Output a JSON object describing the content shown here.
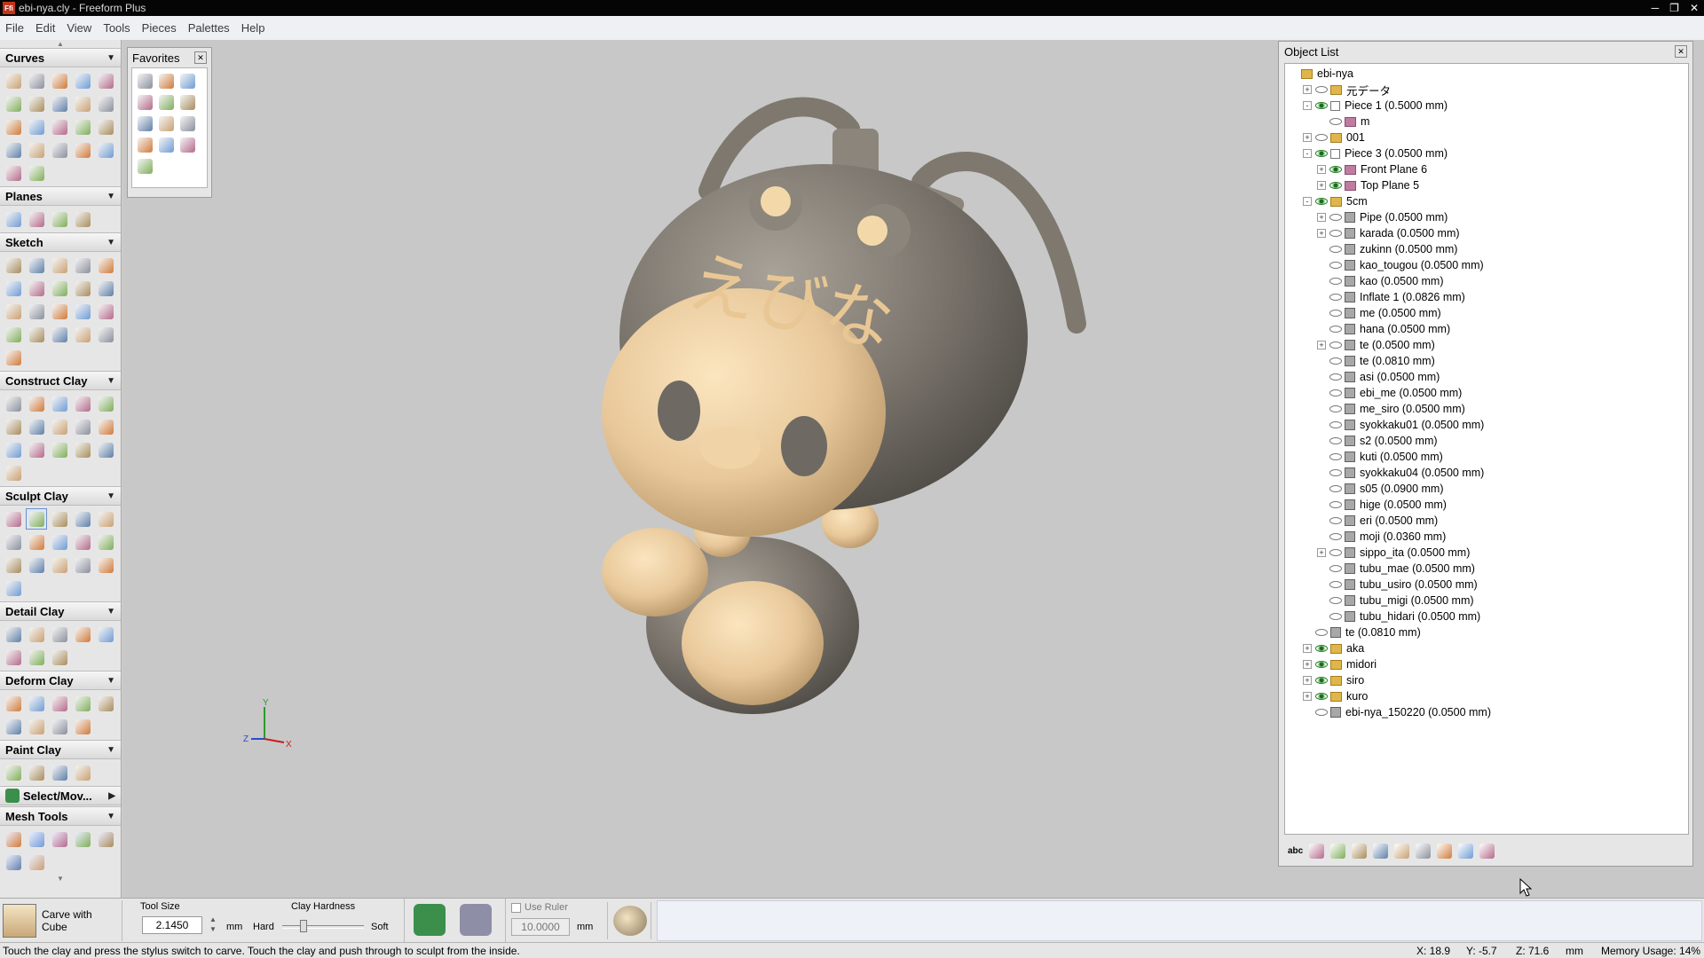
{
  "window": {
    "title": "ebi-nya.cly - Freeform Plus",
    "app_icon": "Ffi",
    "buttons": [
      "─",
      "❐",
      "✕"
    ]
  },
  "menu": [
    "File",
    "Edit",
    "View",
    "Tools",
    "Pieces",
    "Palettes",
    "Help"
  ],
  "palette": {
    "sections": [
      {
        "label": "Curves",
        "rows": 6,
        "count": 22
      },
      {
        "label": "Planes",
        "rows": 1,
        "count": 4
      },
      {
        "label": "Sketch",
        "rows": 5,
        "count": 21
      },
      {
        "label": "Construct Clay",
        "rows": 4,
        "count": 16
      },
      {
        "label": "Sculpt Clay",
        "rows": 4,
        "count": 16
      },
      {
        "label": "Detail Clay",
        "rows": 2,
        "count": 8
      },
      {
        "label": "Deform Clay",
        "rows": 2,
        "count": 9
      },
      {
        "label": "Paint Clay",
        "rows": 1,
        "count": 4
      }
    ],
    "select_move_label": "Select/Mov...",
    "mesh_tools_label": "Mesh Tools"
  },
  "favorites": {
    "title": "Favorites",
    "count": 13
  },
  "viewport": {
    "model_text": "えびな",
    "axis_labels": {
      "x": "X",
      "y": "Y",
      "z": "Z"
    },
    "colors": {
      "background": "#c8c8c8",
      "clay_dark": "#7a746c",
      "clay_light": "#e8c89a"
    }
  },
  "object_list": {
    "title": "Object List",
    "items": [
      {
        "label": "ebi-nya",
        "level": 0,
        "exp": "",
        "eye": "",
        "icon": "fold"
      },
      {
        "label": "元データ",
        "level": 1,
        "exp": "+",
        "eye": "off",
        "icon": "fold"
      },
      {
        "label": "Piece 1 (0.5000 mm)",
        "level": 1,
        "exp": "-",
        "eye": "on",
        "icon": "pp"
      },
      {
        "label": "m",
        "level": 2,
        "exp": "",
        "eye": "off",
        "icon": "pl"
      },
      {
        "label": "001",
        "level": 1,
        "exp": "+",
        "eye": "off",
        "icon": "fold"
      },
      {
        "label": "Piece 3 (0.0500 mm)",
        "level": 1,
        "exp": "-",
        "eye": "on",
        "icon": "pp"
      },
      {
        "label": "Front Plane 6",
        "level": 2,
        "exp": "+",
        "eye": "on",
        "icon": "pl"
      },
      {
        "label": "Top Plane 5",
        "level": 2,
        "exp": "+",
        "eye": "on",
        "icon": "pl"
      },
      {
        "label": "5cm",
        "level": 1,
        "exp": "-",
        "eye": "on",
        "icon": "fold"
      },
      {
        "label": "Pipe (0.0500 mm)",
        "level": 2,
        "exp": "+",
        "eye": "off",
        "icon": "pc"
      },
      {
        "label": "karada (0.0500 mm)",
        "level": 2,
        "exp": "+",
        "eye": "off",
        "icon": "pc"
      },
      {
        "label": "zukinn (0.0500 mm)",
        "level": 2,
        "exp": "",
        "eye": "off",
        "icon": "pc"
      },
      {
        "label": "kao_tougou (0.0500 mm)",
        "level": 2,
        "exp": "",
        "eye": "off",
        "icon": "pc"
      },
      {
        "label": "kao (0.0500 mm)",
        "level": 2,
        "exp": "",
        "eye": "off",
        "icon": "pc"
      },
      {
        "label": "Inflate 1 (0.0826 mm)",
        "level": 2,
        "exp": "",
        "eye": "off",
        "icon": "pc"
      },
      {
        "label": "me (0.0500 mm)",
        "level": 2,
        "exp": "",
        "eye": "off",
        "icon": "pc"
      },
      {
        "label": "hana (0.0500 mm)",
        "level": 2,
        "exp": "",
        "eye": "off",
        "icon": "pc"
      },
      {
        "label": "te (0.0500 mm)",
        "level": 2,
        "exp": "+",
        "eye": "off",
        "icon": "pc"
      },
      {
        "label": "te (0.0810 mm)",
        "level": 2,
        "exp": "",
        "eye": "off",
        "icon": "pc"
      },
      {
        "label": "asi (0.0500 mm)",
        "level": 2,
        "exp": "",
        "eye": "off",
        "icon": "pc"
      },
      {
        "label": "ebi_me (0.0500 mm)",
        "level": 2,
        "exp": "",
        "eye": "off",
        "icon": "pc"
      },
      {
        "label": "me_siro (0.0500 mm)",
        "level": 2,
        "exp": "",
        "eye": "off",
        "icon": "pc"
      },
      {
        "label": "syokkaku01 (0.0500 mm)",
        "level": 2,
        "exp": "",
        "eye": "off",
        "icon": "pc"
      },
      {
        "label": "s2 (0.0500 mm)",
        "level": 2,
        "exp": "",
        "eye": "off",
        "icon": "pc"
      },
      {
        "label": "kuti (0.0500 mm)",
        "level": 2,
        "exp": "",
        "eye": "off",
        "icon": "pc"
      },
      {
        "label": "syokkaku04 (0.0500 mm)",
        "level": 2,
        "exp": "",
        "eye": "off",
        "icon": "pc"
      },
      {
        "label": "s05 (0.0900 mm)",
        "level": 2,
        "exp": "",
        "eye": "off",
        "icon": "pc"
      },
      {
        "label": "hige (0.0500 mm)",
        "level": 2,
        "exp": "",
        "eye": "off",
        "icon": "pc"
      },
      {
        "label": "eri (0.0500 mm)",
        "level": 2,
        "exp": "",
        "eye": "off",
        "icon": "pc"
      },
      {
        "label": "moji (0.0360 mm)",
        "level": 2,
        "exp": "",
        "eye": "off",
        "icon": "pc"
      },
      {
        "label": "sippo_ita (0.0500 mm)",
        "level": 2,
        "exp": "+",
        "eye": "off",
        "icon": "pc"
      },
      {
        "label": "tubu_mae (0.0500 mm)",
        "level": 2,
        "exp": "",
        "eye": "off",
        "icon": "pc"
      },
      {
        "label": "tubu_usiro (0.0500 mm)",
        "level": 2,
        "exp": "",
        "eye": "off",
        "icon": "pc"
      },
      {
        "label": "tubu_migi (0.0500 mm)",
        "level": 2,
        "exp": "",
        "eye": "off",
        "icon": "pc"
      },
      {
        "label": "tubu_hidari (0.0500 mm)",
        "level": 2,
        "exp": "",
        "eye": "off",
        "icon": "pc"
      },
      {
        "label": "te (0.0810 mm)",
        "level": 1,
        "exp": "",
        "eye": "off",
        "icon": "pc"
      },
      {
        "label": "aka",
        "level": 1,
        "exp": "+",
        "eye": "on",
        "icon": "fold"
      },
      {
        "label": "midori",
        "level": 1,
        "exp": "+",
        "eye": "on",
        "icon": "fold"
      },
      {
        "label": "siro",
        "level": 1,
        "exp": "+",
        "eye": "on",
        "icon": "fold"
      },
      {
        "label": "kuro",
        "level": 1,
        "exp": "+",
        "eye": "on",
        "icon": "fold"
      },
      {
        "label": "ebi-nya_150220 (0.0500 mm)",
        "level": 1,
        "exp": "",
        "eye": "off",
        "icon": "pc"
      }
    ],
    "toolbar_label": "abc",
    "toolbar_icons": 9
  },
  "tool_options": {
    "current_tool_line1": "Carve with",
    "current_tool_line2": "Cube",
    "tool_size_label": "Tool Size",
    "tool_size_value": "2.1450",
    "tool_size_unit": "mm",
    "clay_hardness_label": "Clay Hardness",
    "hard_label": "Hard",
    "soft_label": "Soft",
    "use_ruler_label": "Use Ruler",
    "ruler_value": "10.0000",
    "ruler_unit": "mm"
  },
  "status": {
    "message": "Touch the clay and press the stylus switch to carve. Touch the clay and push through to sculpt from the inside.",
    "x": "X:  18.9",
    "y": "Y:  -5.7",
    "z": "Z:  71.6",
    "unit": "mm",
    "memory": "Memory Usage: 14%"
  }
}
